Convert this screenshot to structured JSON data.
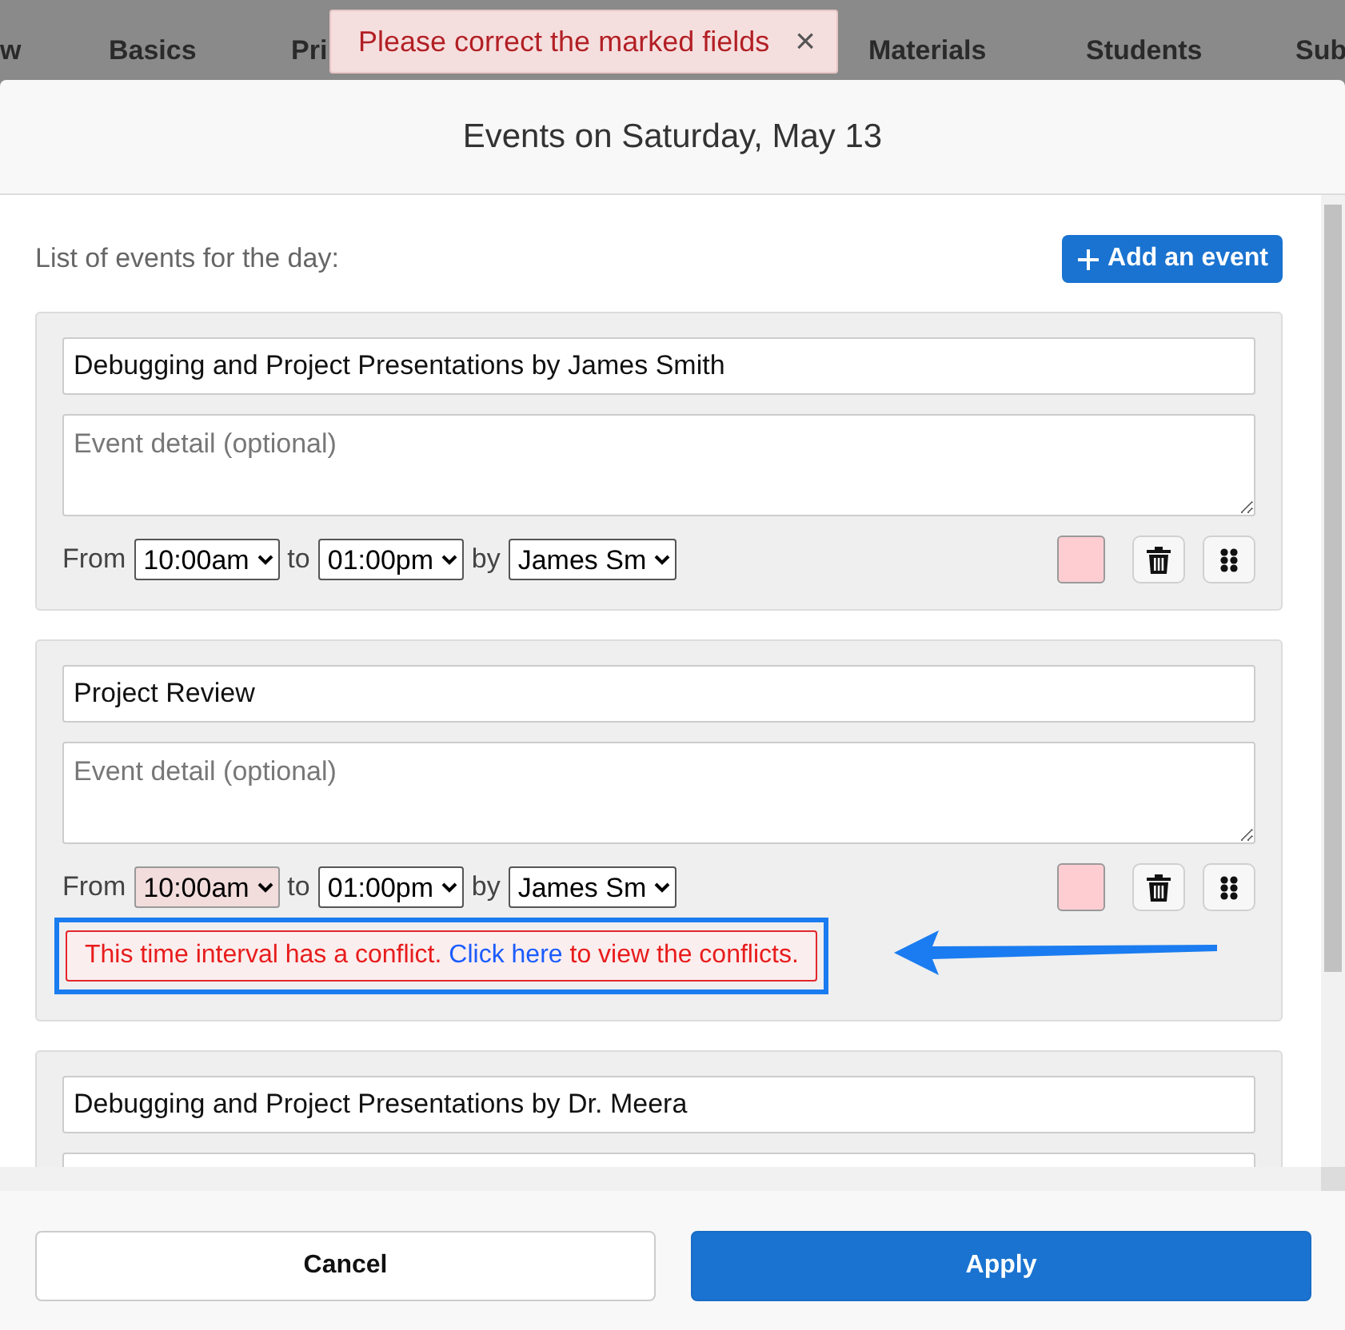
{
  "background_tabs": [
    {
      "label": "w"
    },
    {
      "label": "Basics"
    },
    {
      "label": "Pri"
    },
    {
      "label": "Materials"
    },
    {
      "label": "Students"
    },
    {
      "label": "Sub"
    }
  ],
  "toast": {
    "message": "Please correct the marked fields",
    "close": "×"
  },
  "dialog": {
    "title": "Events on Saturday, May 13",
    "intro": "List of events for the day:",
    "add_button": "Add an event",
    "events": [
      {
        "title": "Debugging and Project Presentations by James Smith",
        "detail_placeholder": "Event detail (optional)",
        "from_label": "From",
        "from": "10:00am",
        "from_invalid": false,
        "to_label": "to",
        "to": "01:00pm",
        "by_label": "by",
        "by": "James Sm",
        "color": "#fdcdd2"
      },
      {
        "title": "Project Review",
        "detail_placeholder": "Event detail (optional)",
        "from_label": "From",
        "from": "10:00am",
        "from_invalid": true,
        "to_label": "to",
        "to": "01:00pm",
        "by_label": "by",
        "by": "James Sm",
        "color": "#fdcdd2",
        "conflict": {
          "before": "This time interval has a conflict.",
          "link": "Click here",
          "after": "to view the conflicts."
        }
      },
      {
        "title": "Debugging and Project Presentations by Dr. Meera"
      }
    ],
    "buttons": [
      {
        "label": "Cancel",
        "kind": "secondary"
      },
      {
        "label": "Apply",
        "kind": "primary"
      }
    ]
  }
}
